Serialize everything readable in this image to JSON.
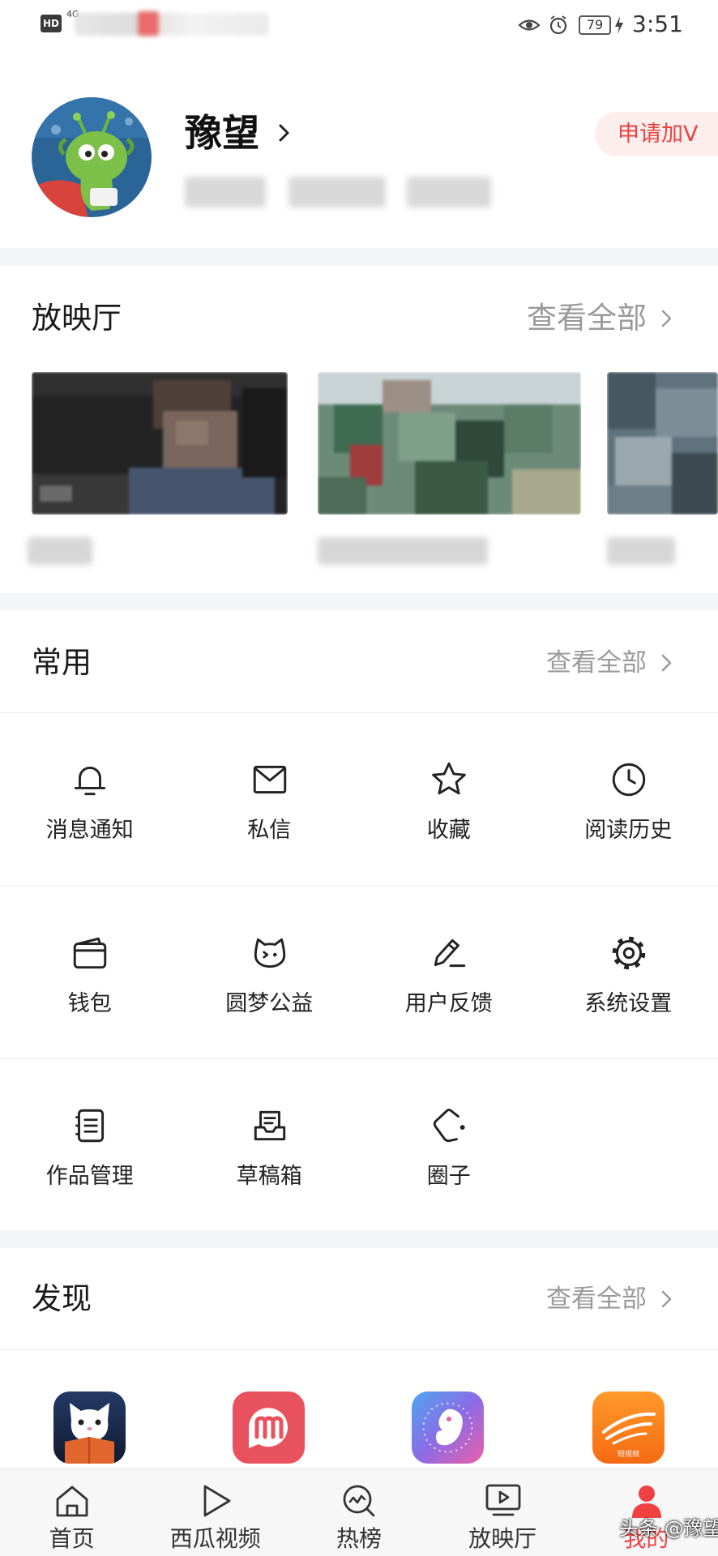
{
  "status_bar": {
    "hd_badge": "HD",
    "network": "4G",
    "battery": "79",
    "time": "3:51"
  },
  "profile": {
    "name": "豫望",
    "verify_button": "申请加V"
  },
  "cinema": {
    "title": "放映厅",
    "view_all": "查看全部"
  },
  "common": {
    "title": "常用",
    "view_all": "查看全部",
    "items": [
      {
        "label": "消息通知",
        "icon": "bell-icon"
      },
      {
        "label": "私信",
        "icon": "envelope-icon"
      },
      {
        "label": "收藏",
        "icon": "star-icon"
      },
      {
        "label": "阅读历史",
        "icon": "clock-icon"
      },
      {
        "label": "钱包",
        "icon": "wallet-icon"
      },
      {
        "label": "圆梦公益",
        "icon": "cat-face-icon"
      },
      {
        "label": "用户反馈",
        "icon": "pen-icon"
      },
      {
        "label": "系统设置",
        "icon": "gear-icon"
      },
      {
        "label": "作品管理",
        "icon": "notebook-icon"
      },
      {
        "label": "草稿箱",
        "icon": "draft-tray-icon"
      },
      {
        "label": "圈子",
        "icon": "circle-group-icon"
      }
    ]
  },
  "discover": {
    "title": "发现",
    "view_all": "查看全部",
    "apps": [
      {
        "icon": "cat-reading-app-icon"
      },
      {
        "icon": "pink-m-app-icon"
      },
      {
        "icon": "pregnancy-app-icon"
      },
      {
        "icon": "orange-video-app-icon",
        "logo_text": "短视频"
      }
    ]
  },
  "tab_bar": {
    "active": "我的",
    "tabs": [
      {
        "label": "首页",
        "icon": "home-icon"
      },
      {
        "label": "西瓜视频",
        "icon": "play-icon"
      },
      {
        "label": "热榜",
        "icon": "hot-search-icon"
      },
      {
        "label": "放映厅",
        "icon": "cinema-screen-icon"
      },
      {
        "label": "我的",
        "icon": "person-icon"
      }
    ]
  },
  "watermark": "头条 @豫望",
  "colors": {
    "accent": "#f04142",
    "text": "#222222",
    "muted": "#999999",
    "divider": "#f4f5f6",
    "tab_bar_bg": "#f7f7f8"
  }
}
